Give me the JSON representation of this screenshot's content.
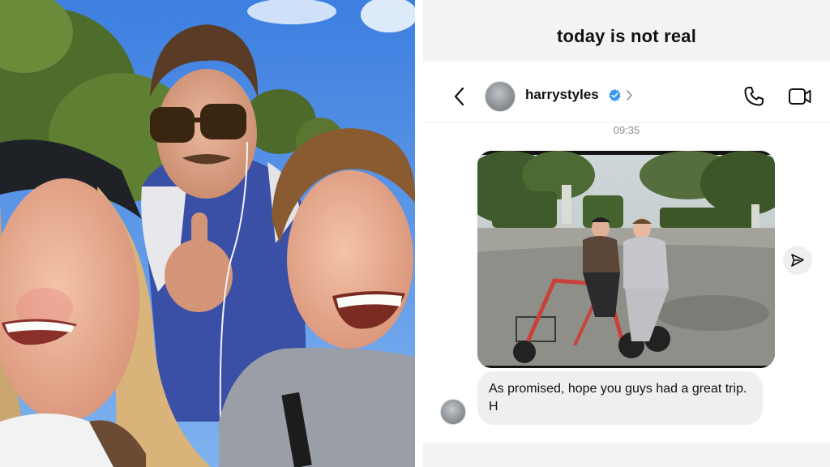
{
  "caption": "today is not real",
  "chat": {
    "username": "harrystyles",
    "timestamp": "09:35",
    "message": "As promised, hope you guys had a great trip. H"
  },
  "icons": {
    "back": "chevron-left-icon",
    "verified": "verified-badge-icon",
    "profile": "chevron-right-icon",
    "call": "phone-icon",
    "video": "video-camera-icon",
    "share": "send-paper-plane-icon"
  },
  "colors": {
    "verified_blue": "#3897f0",
    "bubble_gray": "#efefef",
    "caption_bg": "#f3f3f5",
    "text": "#111111",
    "meta_text": "#8e8e8e"
  }
}
